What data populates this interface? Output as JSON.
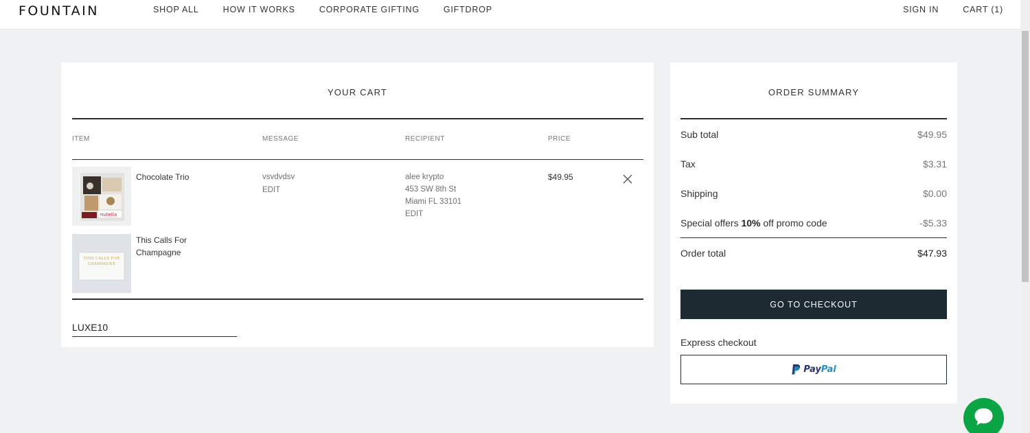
{
  "header": {
    "logo": "FOUNTAIN",
    "nav": [
      "SHOP ALL",
      "HOW IT WORKS",
      "CORPORATE GIFTING",
      "GIFTDROP"
    ],
    "sign_in": "SIGN IN",
    "cart": "CART (1)"
  },
  "cart": {
    "title": "YOUR CART",
    "columns": {
      "item": "ITEM",
      "message": "MESSAGE",
      "recipient": "RECIPIENT",
      "price": "PRICE"
    },
    "items": [
      {
        "name": "Chocolate Trio",
        "thumbnail_icon": "chocolate-box-image"
      },
      {
        "name": "This Calls For Champagne",
        "thumbnail_icon": "greeting-card-image",
        "card_text": "THIS CALLS FOR CHAMPAGNE"
      }
    ],
    "message": {
      "text": "vsvdvdsv",
      "edit": "EDIT"
    },
    "recipient": {
      "name": "alee krypto",
      "address1": "453 SW 8th St",
      "address2": "Miami FL 33101",
      "edit": "EDIT"
    },
    "price": "$49.95",
    "promo_code_value": "LUXE10"
  },
  "summary": {
    "title": "ORDER SUMMARY",
    "rows": [
      {
        "label": "Sub total",
        "value": "$49.95"
      },
      {
        "label": "Tax",
        "value": "$3.31"
      },
      {
        "label": "Shipping",
        "value": "$0.00"
      }
    ],
    "special": {
      "prefix": "Special offers ",
      "percent": "10%",
      "suffix": " off promo code",
      "value": "-$5.33"
    },
    "total": {
      "label": "Order total",
      "value": "$47.93"
    },
    "checkout_label": "GO TO CHECKOUT",
    "express_label": "Express checkout",
    "paypal": {
      "pay": "Pay",
      "pal": "Pal"
    }
  },
  "colors": {
    "checkout_button": "#1e2a32",
    "chat_bubble": "#0ca545",
    "paypal_dark": "#27346a",
    "paypal_light": "#2790c3"
  }
}
